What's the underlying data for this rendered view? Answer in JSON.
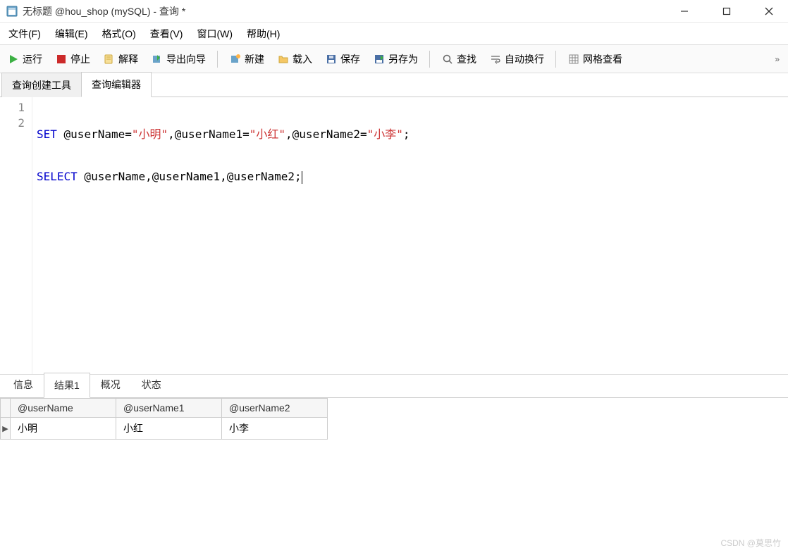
{
  "window": {
    "title": "无标题 @hou_shop (mySQL) - 查询 *"
  },
  "menu": {
    "file": "文件(F)",
    "edit": "编辑(E)",
    "format": "格式(O)",
    "view": "查看(V)",
    "window": "窗口(W)",
    "help": "帮助(H)"
  },
  "toolbar": {
    "run": "运行",
    "stop": "停止",
    "explain": "解释",
    "export_wizard": "导出向导",
    "new": "新建",
    "load": "载入",
    "save": "保存",
    "save_as": "另存为",
    "find": "查找",
    "auto_wrap": "自动换行",
    "grid_view": "网格查看"
  },
  "editor_tabs": {
    "builder": "查询创建工具",
    "editor": "查询编辑器"
  },
  "code": {
    "line_numbers": [
      "1",
      "2"
    ],
    "l1": {
      "kw": "SET",
      "p1": " @userName=",
      "s1": "\"小明\"",
      "p2": ",@userName1=",
      "s2": "\"小红\"",
      "p3": ",@userName2=",
      "s3": "\"小李\"",
      "p4": ";"
    },
    "l2": {
      "kw": "SELECT",
      "p1": " @userName,@userName1,@userName2;"
    }
  },
  "result_tabs": {
    "info": "信息",
    "result1": "结果1",
    "profile": "概况",
    "status": "状态"
  },
  "result": {
    "row_marker": "▶",
    "columns": [
      "@userName",
      "@userName1",
      "@userName2"
    ],
    "rows": [
      [
        "小明",
        "小红",
        "小李"
      ]
    ]
  },
  "watermark": "CSDN @莫思竹"
}
